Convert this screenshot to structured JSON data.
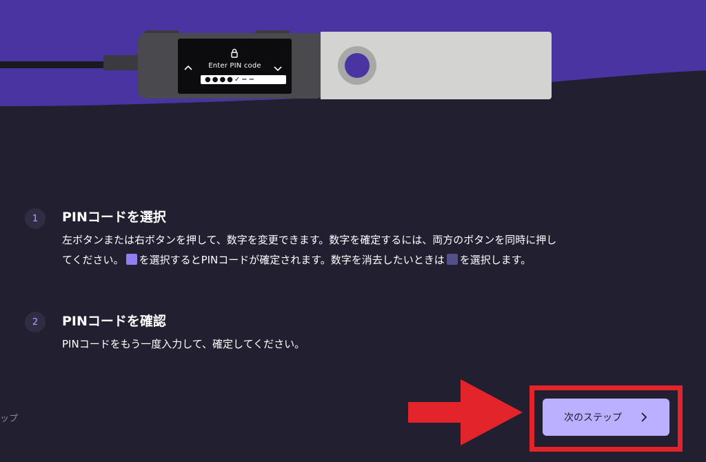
{
  "device": {
    "screen_label": "Enter PIN code",
    "pin_display": "●●●●✓−−"
  },
  "steps": [
    {
      "number": "1",
      "title": "PINコードを選択",
      "body_part1": "左ボタンまたは右ボタンを押して、数字を変更できます。数字を確定するには、両方のボタンを同時に押してください。",
      "body_part2": "を選択するとPINコードが確定されます。数字を消去したいときは",
      "body_part3": "を選択します。"
    },
    {
      "number": "2",
      "title": "PINコードを確認",
      "body": "PINコードをもう一度入力して、確定してください。"
    }
  ],
  "side_text": "ップ",
  "next_button": {
    "label": "次のステップ"
  },
  "colors": {
    "background": "#222030",
    "hero_purple": "#4a34a2",
    "button": "#bbb0ff",
    "highlight": "#e3242b"
  }
}
